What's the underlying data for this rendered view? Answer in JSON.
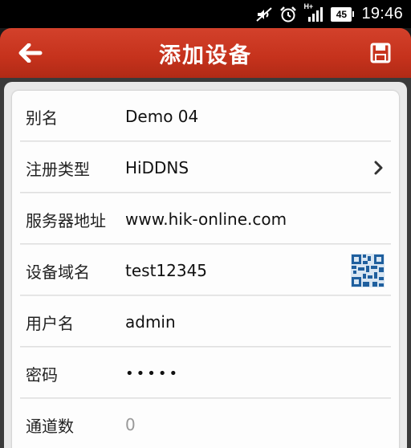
{
  "status_bar": {
    "network": "H+",
    "battery_level": "45",
    "time": "19:46",
    "icons": [
      "mute-icon",
      "alarm-icon",
      "signal-icon",
      "battery-icon"
    ]
  },
  "header": {
    "title": "添加设备",
    "back_icon": "back-arrow-icon",
    "save_icon": "save-icon",
    "accent_color": "#c5321c"
  },
  "form": {
    "fields": [
      {
        "label": "别名",
        "value": "Demo 04"
      },
      {
        "label": "注册类型",
        "value": "HiDDNS"
      },
      {
        "label": "服务器地址",
        "value": "www.hik-online.com"
      },
      {
        "label": "设备域名",
        "value": "test12345"
      },
      {
        "label": "用户名",
        "value": "admin"
      },
      {
        "label": "密码",
        "value": "•••••"
      },
      {
        "label": "通道数",
        "value": "0"
      }
    ]
  }
}
